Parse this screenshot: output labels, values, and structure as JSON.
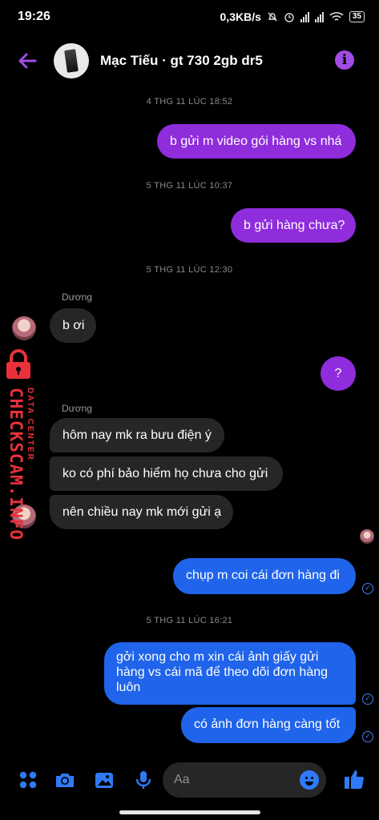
{
  "status_bar": {
    "time": "19:26",
    "speed": "0,3KB/s",
    "battery": "35"
  },
  "header": {
    "title": "Mạc Tiếu · gt 730 2gb dr5",
    "info_label": "i"
  },
  "messages": {
    "ts1": "4 THG 11 LÚC 18:52",
    "m1": "b gửi m video gói hàng vs nhá",
    "ts2": "5 THG 11 LÚC 10:37",
    "m2": "b gửi hàng chưa?",
    "ts3": "5 THG 11 LÚC 12:30",
    "sender1": "Dương",
    "m3": "b ơi",
    "m4": "?",
    "sender2": "Dương",
    "m5": "hôm nay mk ra bưu điện ý",
    "m6": "ko có phí bảo hiểm họ chưa cho gửi",
    "m7": "nên chiều nay mk mới gửi ạ",
    "m8": "chụp m coi cái đơn hàng đi",
    "ts4": "5 THG 11 LÚC 16:21",
    "m9_line1": "gởi xong cho m xin cái ảnh giấy gửi",
    "m9_line2": "hàng vs cái mã để theo dõi đơn hàng",
    "m9_line3": "luôn",
    "m10": "có ảnh đơn hàng càng tốt"
  },
  "composer": {
    "placeholder": "Aa"
  },
  "watermark": {
    "main": "CHECKSCAM.INFO",
    "sub": "DATA CENTER"
  },
  "colors": {
    "purple": "#8f2cdb",
    "blue": "#1f64ea",
    "incoming": "#262626",
    "accent": "#a14ce6",
    "watermark": "#e8313b"
  },
  "icons": [
    "back-arrow-icon",
    "info-icon",
    "menu-dots-icon",
    "camera-icon",
    "image-icon",
    "microphone-icon",
    "emoji-icon",
    "like-thumb-icon",
    "seen-check-icon",
    "lock-icon"
  ]
}
